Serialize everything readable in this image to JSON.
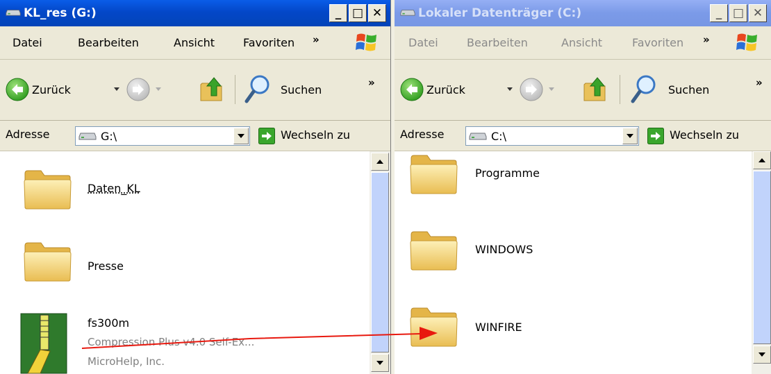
{
  "left_window": {
    "title": "KL_res (G:)",
    "menu": [
      "Datei",
      "Bearbeiten",
      "Ansicht",
      "Favoriten"
    ],
    "menu_overflow": "»",
    "toolbar": {
      "back": "Zurück",
      "search": "Suchen",
      "overflow": "»"
    },
    "address": {
      "label": "Adresse",
      "value": "G:\\",
      "go": "Wechseln zu"
    },
    "items": [
      {
        "name": "Daten_KL",
        "type": "folder"
      },
      {
        "name": "Presse",
        "type": "folder"
      },
      {
        "name": "fs300m",
        "type": "archive",
        "desc": "Compression Plus v4.0 Self-Ex...",
        "company": "MicroHelp, Inc."
      }
    ]
  },
  "right_window": {
    "title": "Lokaler Datenträger (C:)",
    "menu": [
      "Datei",
      "Bearbeiten",
      "Ansicht",
      "Favoriten"
    ],
    "menu_overflow": "»",
    "toolbar": {
      "back": "Zurück",
      "search": "Suchen",
      "overflow": "»"
    },
    "address": {
      "label": "Adresse",
      "value": "C:\\",
      "go": "Wechseln zu"
    },
    "items": [
      {
        "name": "Programme",
        "type": "folder"
      },
      {
        "name": "WINDOWS",
        "type": "folder"
      },
      {
        "name": "WINFIRE",
        "type": "folder"
      }
    ]
  },
  "window_controls": {
    "minimize": "_",
    "maximize": "□",
    "close": "✕"
  },
  "icons": [
    "drive-icon",
    "back-arrow-icon",
    "forward-arrow-icon",
    "up-folder-icon",
    "search-icon",
    "go-arrow-icon",
    "folder-icon",
    "zip-archive-icon",
    "windows-flag-icon"
  ],
  "colors": {
    "title_active": "#0347c8",
    "title_inactive": "#7b9ae8",
    "drag_arrow": "#e8190f",
    "folder": "#f5d77b"
  }
}
